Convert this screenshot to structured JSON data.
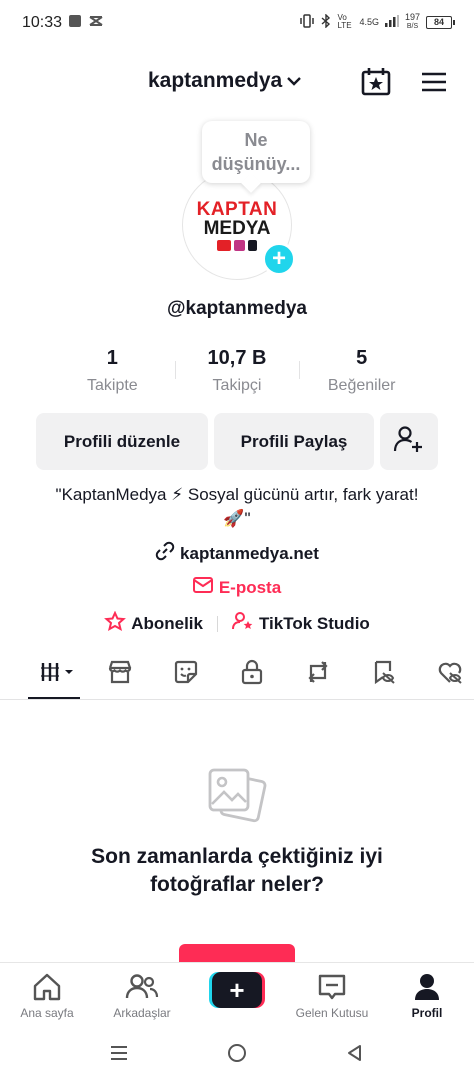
{
  "status_bar": {
    "time": "10:33",
    "network": "4.5G",
    "lte_label": "Vo LTE",
    "speed": "197",
    "speed_unit": "B/S",
    "battery": "84"
  },
  "header": {
    "username": "kaptanmedya",
    "icons": [
      "calendar-star-icon",
      "hamburger-menu-icon"
    ]
  },
  "profile": {
    "note_bubble": "Ne düşünüy...",
    "avatar_logo_line1": "KAPTAN",
    "avatar_logo_line2": "MEDYA",
    "handle": "@kaptanmedya",
    "stats": [
      {
        "value": "1",
        "label": "Takipte"
      },
      {
        "value": "10,7 B",
        "label": "Takipçi"
      },
      {
        "value": "5",
        "label": "Beğeniler"
      }
    ],
    "buttons": {
      "edit": "Profili düzenle",
      "share": "Profili Paylaş"
    },
    "bio": "\"KaptanMedya ⚡ Sosyal gücünü artır, fark yarat! 🚀\"",
    "website": "kaptanmedya.net",
    "email": "E-posta",
    "subscription": "Abonelik",
    "studio": "TikTok Studio"
  },
  "tabs": [
    "videos-grid-icon",
    "shop-icon",
    "sticker-icon",
    "lock-icon",
    "repost-icon",
    "favorites-icon",
    "liked-icon"
  ],
  "empty_state": {
    "text": "Son zamanlarda çektiğiniz iyi fotoğraflar neler?"
  },
  "bottom_nav": [
    {
      "label": "Ana sayfa"
    },
    {
      "label": "Arkadaşlar"
    },
    {
      "label": "Gelen Kutusu"
    },
    {
      "label": "Profil"
    }
  ],
  "colors": {
    "accent": "#fe2c55",
    "cyan": "#20d5ec",
    "text": "#161823",
    "muted": "#8a8b91"
  }
}
